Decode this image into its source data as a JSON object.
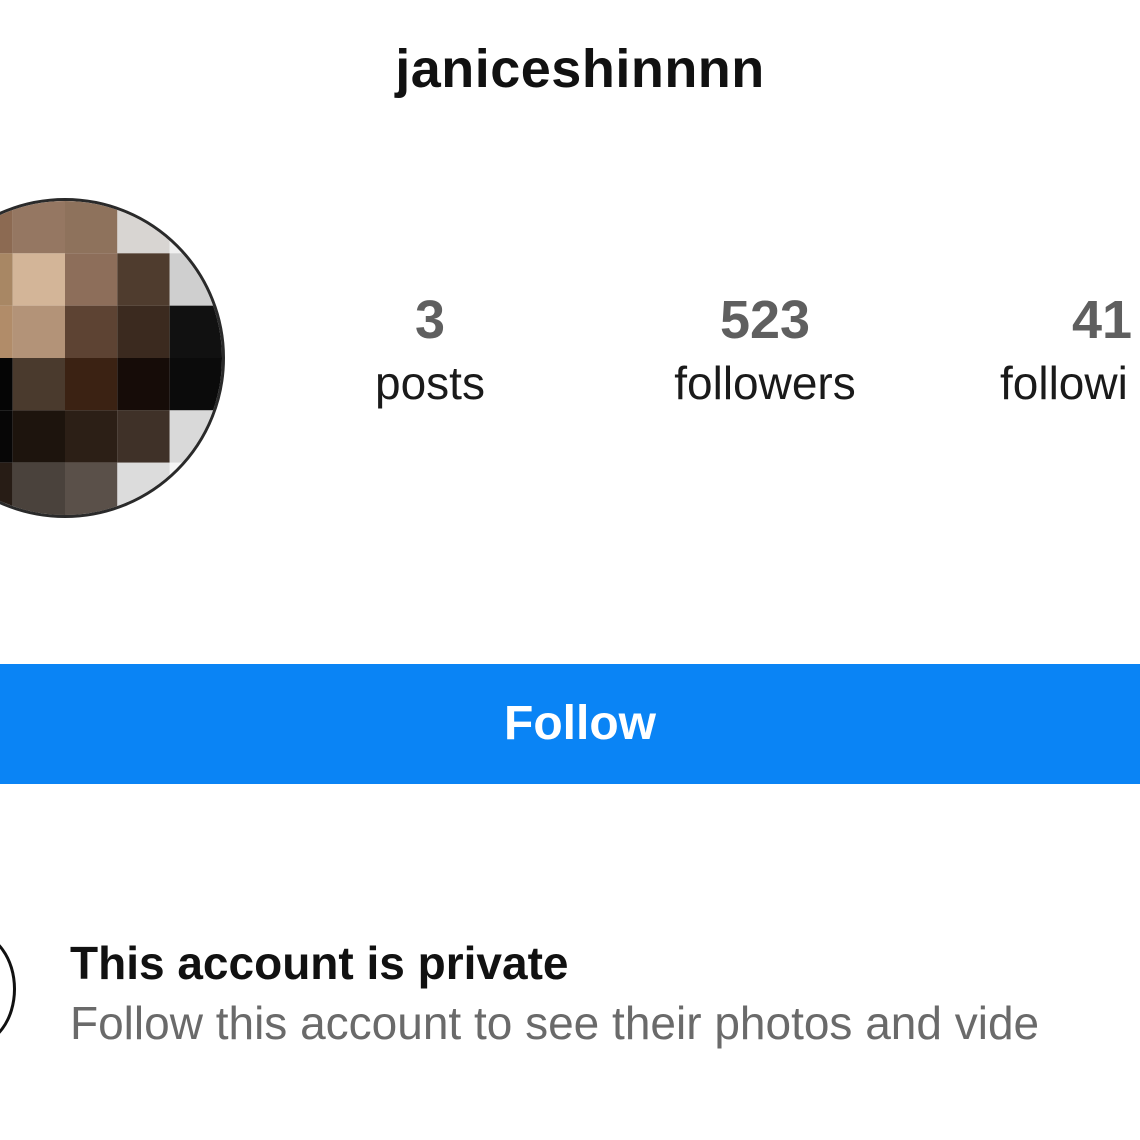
{
  "header": {
    "username": "janiceshinnnn"
  },
  "avatar": {
    "description_icon": "pixelated-profile-photo"
  },
  "stats": {
    "posts": {
      "count": "3",
      "label": "posts"
    },
    "followers": {
      "count": "523",
      "label": "followers"
    },
    "following": {
      "count": "41",
      "label": "followi"
    }
  },
  "actions": {
    "follow_label": "Follow",
    "follow_color": "#0a84f5"
  },
  "private_notice": {
    "icon": "lock-icon",
    "title": "This account is private",
    "subtitle": "Follow this account to see their photos and vide"
  }
}
